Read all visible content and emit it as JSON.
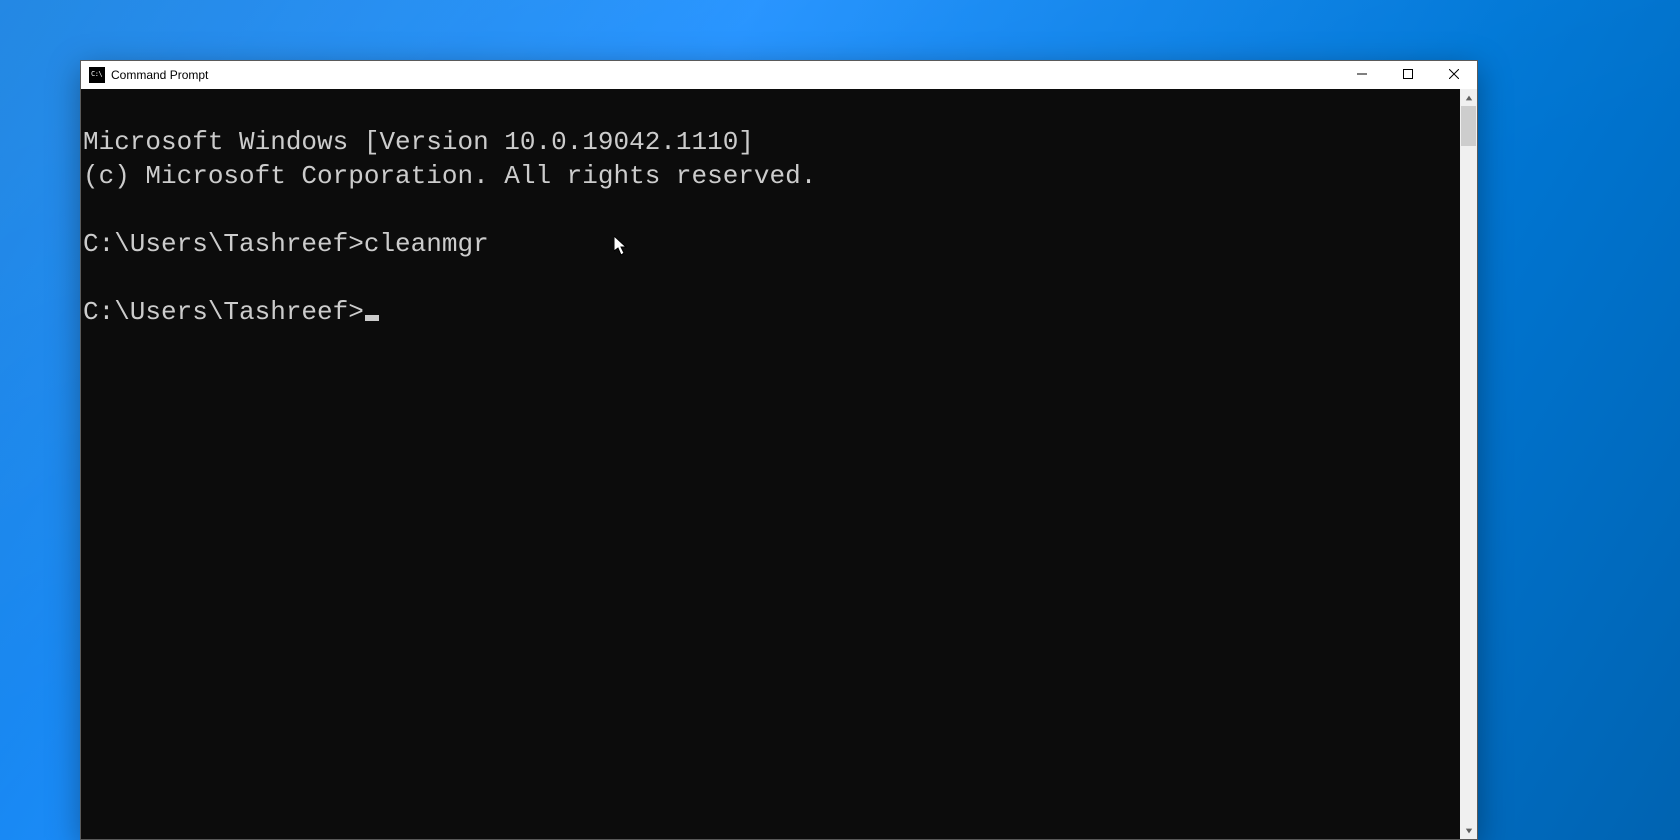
{
  "window": {
    "title": "Command Prompt"
  },
  "console": {
    "line1": "Microsoft Windows [Version 10.0.19042.1110]",
    "line2": "(c) Microsoft Corporation. All rights reserved.",
    "blank1": "",
    "prompt1": "C:\\Users\\Tashreef>cleanmgr",
    "blank2": "",
    "prompt2": "C:\\Users\\Tashreef>"
  }
}
